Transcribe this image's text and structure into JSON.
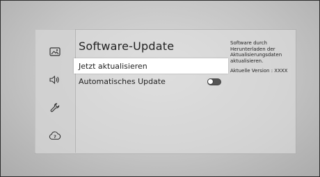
{
  "screen": {
    "title": "Software-Update",
    "menu": [
      {
        "label": "Jetzt aktualisieren",
        "selected": true
      },
      {
        "label": "Automatisches Update",
        "toggle_on": false
      }
    ],
    "info": {
      "description": "Software durch Herunterladen der Aktualisierungsdaten aktualisieren.",
      "version": "Aktuelle Version : XXXX"
    }
  },
  "sidebar": {
    "icons": [
      "picture-icon",
      "sound-icon",
      "support-wrench-icon",
      "cloud-help-icon"
    ]
  },
  "colors": {
    "selected_bg": "#ffffff",
    "text": "#222222",
    "toggle_off": "#555555"
  }
}
